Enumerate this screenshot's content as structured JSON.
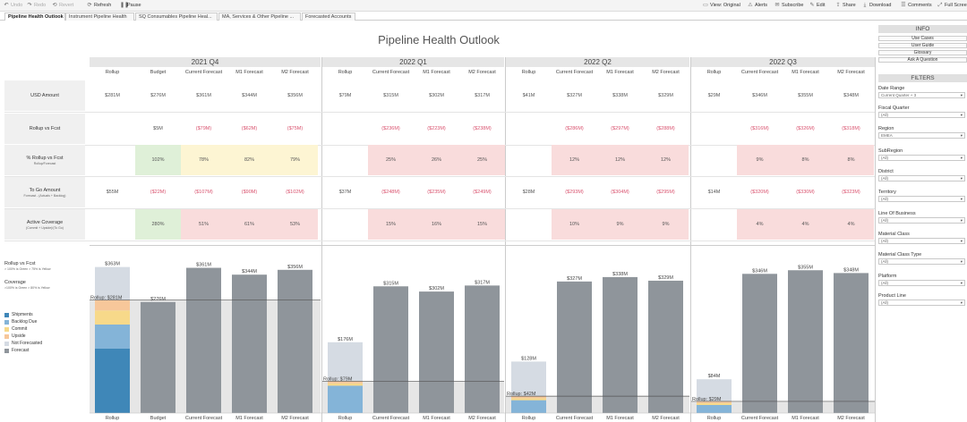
{
  "toolbar": {
    "left": [
      {
        "icon": "undo-icon",
        "label": "Undo",
        "enabled": false
      },
      {
        "icon": "redo-icon",
        "label": "Redo",
        "enabled": false
      },
      {
        "icon": "revert-icon",
        "label": "Revert",
        "enabled": false
      },
      {
        "icon": "refresh-icon",
        "label": "Refresh",
        "enabled": true
      },
      {
        "icon": "pause-icon",
        "label": "Pause",
        "enabled": true
      }
    ],
    "right": [
      {
        "icon": "view-original-icon",
        "label": "View: Original"
      },
      {
        "icon": "alerts-icon",
        "label": "Alerts"
      },
      {
        "icon": "subscribe-icon",
        "label": "Subscribe"
      },
      {
        "icon": "edit-icon",
        "label": "Edit"
      },
      {
        "icon": "share-icon",
        "label": "Share"
      },
      {
        "icon": "download-icon",
        "label": "Download"
      },
      {
        "icon": "comments-icon",
        "label": "Comments"
      },
      {
        "icon": "full-screen-icon",
        "label": "Full Screen"
      }
    ]
  },
  "tabs": [
    {
      "label": "Pipeline Health Outlook",
      "active": true
    },
    {
      "label": "Instrument Pipeline Health",
      "active": false
    },
    {
      "label": "SQ Consumables Pipeline Heal...",
      "active": false
    },
    {
      "label": "MA, Services & Other Pipeline ...",
      "active": false
    },
    {
      "label": "Forecasted Accounts",
      "active": false
    }
  ],
  "title": "Pipeline Health Outlook",
  "quarters": [
    {
      "name": "2021 Q4",
      "columns": [
        "Rollup",
        "Budget",
        "Current Forecast",
        "M1 Forecast",
        "M2 Forecast"
      ]
    },
    {
      "name": "2022 Q1",
      "columns": [
        "Rollup",
        "Current Forecast",
        "M1 Forecast",
        "M2 Forecast"
      ]
    },
    {
      "name": "2022 Q2",
      "columns": [
        "Rollup",
        "Current Forecast",
        "M1 Forecast",
        "M2 Forecast"
      ]
    },
    {
      "name": "2022 Q3",
      "columns": [
        "Rollup",
        "Current Forecast",
        "M1 Forecast",
        "M2 Forecast"
      ]
    }
  ],
  "rows": [
    {
      "label": "USD Amount",
      "sub": ""
    },
    {
      "label": "Rollup vs Fcst",
      "sub": ""
    },
    {
      "label": "% Rollup vs Fcst",
      "sub": "Rollup/Forecast"
    },
    {
      "label": "To Go Amount",
      "sub": "Forecast - (Actuals + Backlog)"
    },
    {
      "label": "Active Coverage",
      "sub": "(Commit + Upside)/(To Go)"
    }
  ],
  "cells": [
    [
      [
        "$281M",
        "$276M",
        "$361M",
        "$344M",
        "$356M"
      ],
      [
        "",
        "$5M",
        "($79M)",
        "($62M)",
        "($75M)"
      ],
      [
        "",
        "102%",
        "78%",
        "82%",
        "79%"
      ],
      [
        "$55M",
        "($22M)",
        "($107M)",
        "($90M)",
        "($102M)"
      ],
      [
        "",
        "280%",
        "51%",
        "61%",
        "53%"
      ]
    ],
    [
      [
        "$79M",
        "$315M",
        "$302M",
        "$317M"
      ],
      [
        "",
        "($236M)",
        "($223M)",
        "($238M)"
      ],
      [
        "",
        "25%",
        "26%",
        "25%"
      ],
      [
        "$37M",
        "($248M)",
        "($235M)",
        "($249M)"
      ],
      [
        "",
        "15%",
        "16%",
        "15%"
      ]
    ],
    [
      [
        "$41M",
        "$327M",
        "$338M",
        "$329M"
      ],
      [
        "",
        "($286M)",
        "($297M)",
        "($288M)"
      ],
      [
        "",
        "12%",
        "12%",
        "12%"
      ],
      [
        "$28M",
        "($293M)",
        "($304M)",
        "($295M)"
      ],
      [
        "",
        "10%",
        "9%",
        "9%"
      ]
    ],
    [
      [
        "$29M",
        "$346M",
        "$355M",
        "$348M"
      ],
      [
        "",
        "($316M)",
        "($326M)",
        "($318M)"
      ],
      [
        "",
        "9%",
        "8%",
        "8%"
      ],
      [
        "$14M",
        "($320M)",
        "($330M)",
        "($323M)"
      ],
      [
        "",
        "4%",
        "4%",
        "4%"
      ]
    ]
  ],
  "cell_colors": {
    "g": "#dff0d8",
    "y": "#fdf5d3",
    "r": "#f9dcdc"
  },
  "cell_bg": [
    [
      [
        "",
        "",
        "",
        "",
        ""
      ],
      [
        "",
        "",
        "",
        "",
        ""
      ],
      [
        "",
        "g",
        "y",
        "y",
        "y"
      ],
      [
        "",
        "",
        "",
        "",
        ""
      ],
      [
        "",
        "g",
        "r",
        "r",
        "r"
      ]
    ],
    [
      [
        "",
        "",
        "",
        ""
      ],
      [
        "",
        "",
        "",
        ""
      ],
      [
        "",
        "r",
        "r",
        "r"
      ],
      [
        "",
        "",
        "",
        ""
      ],
      [
        "",
        "r",
        "r",
        "r"
      ]
    ],
    [
      [
        "",
        "",
        "",
        ""
      ],
      [
        "",
        "",
        "",
        ""
      ],
      [
        "",
        "r",
        "r",
        "r"
      ],
      [
        "",
        "",
        "",
        ""
      ],
      [
        "",
        "r",
        "r",
        "r"
      ]
    ],
    [
      [
        "",
        "",
        "",
        ""
      ],
      [
        "",
        "",
        "",
        ""
      ],
      [
        "",
        "r",
        "r",
        "r"
      ],
      [
        "",
        "",
        "",
        ""
      ],
      [
        "",
        "r",
        "r",
        "r"
      ]
    ]
  ],
  "legend": {
    "rollup_title": "Rollup vs Fcst",
    "rollup_sub": "> 100% is Green > 75% is Yellow",
    "coverage_title": "Coverage",
    "coverage_sub": ">100% is Green > 80% is Yellow",
    "items": [
      {
        "label": "Shipments",
        "color": "#3f87b8"
      },
      {
        "label": "Backlog Due",
        "color": "#84b4d8"
      },
      {
        "label": "Commit",
        "color": "#f7d98a"
      },
      {
        "label": "Upside",
        "color": "#f7c79a"
      },
      {
        "label": "Not Forecasted",
        "color": "#d5dbe3"
      },
      {
        "label": "Forecast",
        "color": "#8f959b"
      }
    ]
  },
  "chart_data": {
    "type": "bar",
    "title": "",
    "ylim": [
      0,
      400
    ],
    "groups": [
      {
        "quarter": "2021 Q4",
        "rollup_label": "Rollup: $281M",
        "rollup_total": 281,
        "stack": {
          "total_label": "$363M",
          "shipments": 160,
          "backlog_due": 60,
          "commit": 35,
          "upside": 26,
          "not_forecasted": 82
        },
        "bars": [
          {
            "category": "Budget",
            "label": "$276M",
            "value": 276
          },
          {
            "category": "Current Forecast",
            "label": "$361M",
            "value": 361
          },
          {
            "category": "M1 Forecast",
            "label": "$344M",
            "value": 344
          },
          {
            "category": "M2 Forecast",
            "label": "$356M",
            "value": 356
          }
        ]
      },
      {
        "quarter": "2022 Q1",
        "rollup_label": "Rollup: $79M",
        "rollup_total": 79,
        "stack": {
          "total_label": "$176M",
          "shipments": 0,
          "backlog_due": 68,
          "commit": 6,
          "upside": 5,
          "not_forecasted": 97
        },
        "bars": [
          {
            "category": "Current Forecast",
            "label": "$315M",
            "value": 315
          },
          {
            "category": "M1 Forecast",
            "label": "$302M",
            "value": 302
          },
          {
            "category": "M2 Forecast",
            "label": "$317M",
            "value": 317
          }
        ]
      },
      {
        "quarter": "2022 Q2",
        "rollup_label": "Rollup: $42M",
        "rollup_total": 42,
        "stack": {
          "total_label": "$128M",
          "shipments": 0,
          "backlog_due": 32,
          "commit": 5,
          "upside": 5,
          "not_forecasted": 86
        },
        "bars": [
          {
            "category": "Current Forecast",
            "label": "$327M",
            "value": 327
          },
          {
            "category": "M1 Forecast",
            "label": "$338M",
            "value": 338
          },
          {
            "category": "M2 Forecast",
            "label": "$329M",
            "value": 329
          }
        ]
      },
      {
        "quarter": "2022 Q3",
        "rollup_label": "Rollup: $29M",
        "rollup_total": 29,
        "stack": {
          "total_label": "$84M",
          "shipments": 0,
          "backlog_due": 20,
          "commit": 5,
          "upside": 4,
          "not_forecasted": 55
        },
        "bars": [
          {
            "category": "Current Forecast",
            "label": "$346M",
            "value": 346
          },
          {
            "category": "M1 Forecast",
            "label": "$355M",
            "value": 355
          },
          {
            "category": "M2 Forecast",
            "label": "$348M",
            "value": 348
          }
        ]
      }
    ]
  },
  "right_panel": {
    "info_title": "INFO",
    "links": [
      "Use Cases",
      "User Guide",
      "Glossary",
      "Ask A Question"
    ],
    "filters_title": "FILTERS",
    "filters": [
      {
        "label": "Date Range",
        "value": "Current Quarter + 3"
      },
      {
        "label": "Fiscal Quarter",
        "value": "(All)"
      },
      {
        "label": "Region",
        "value": "EMEA"
      },
      {
        "label": "SubRegion",
        "value": "(All)"
      },
      {
        "label": "District",
        "value": "(All)"
      },
      {
        "label": "Territory",
        "value": "(All)"
      },
      {
        "label": "Line Of Business",
        "value": "(All)"
      },
      {
        "label": "Material Class",
        "value": "(All)"
      },
      {
        "label": "Material Class Type",
        "value": "(All)"
      },
      {
        "label": "Platform",
        "value": "(All)"
      },
      {
        "label": "Product Line",
        "value": "(All)"
      }
    ]
  }
}
